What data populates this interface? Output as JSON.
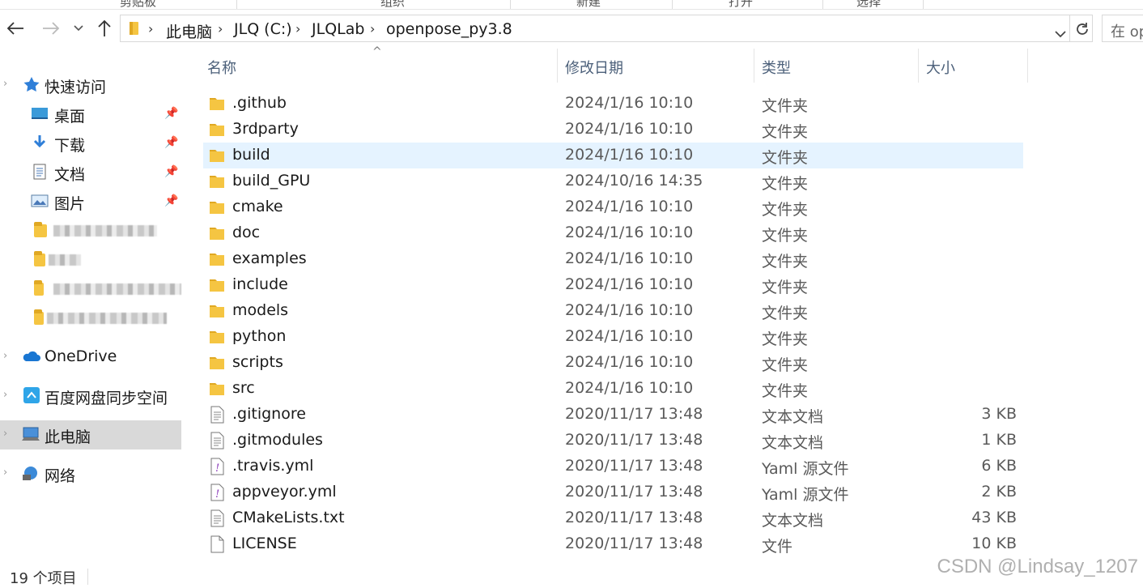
{
  "ribbon": {
    "items": [
      "剪贴板",
      "组织",
      "新建",
      "打开",
      "选择"
    ]
  },
  "nav": {
    "breadcrumbs": [
      "此电脑",
      "JLQ (C:)",
      "JLQLab",
      "openpose_py3.8"
    ],
    "search_placeholder": "在 op"
  },
  "sidebar": {
    "quick_access": "快速访问",
    "pinned": [
      "桌面",
      "下载",
      "文档",
      "图片"
    ],
    "onedrive": "OneDrive",
    "baidu": "百度网盘同步空间",
    "this_pc": "此电脑",
    "network": "网络"
  },
  "columns": {
    "name": "名称",
    "date": "修改日期",
    "type": "类型",
    "size": "大小"
  },
  "files": [
    {
      "name": ".github",
      "date": "2024/1/16 10:10",
      "type": "文件夹",
      "size": "",
      "kind": "folder"
    },
    {
      "name": "3rdparty",
      "date": "2024/1/16 10:10",
      "type": "文件夹",
      "size": "",
      "kind": "folder"
    },
    {
      "name": "build",
      "date": "2024/1/16 10:10",
      "type": "文件夹",
      "size": "",
      "kind": "folder",
      "selected": true
    },
    {
      "name": "build_GPU",
      "date": "2024/10/16 14:35",
      "type": "文件夹",
      "size": "",
      "kind": "folder"
    },
    {
      "name": "cmake",
      "date": "2024/1/16 10:10",
      "type": "文件夹",
      "size": "",
      "kind": "folder"
    },
    {
      "name": "doc",
      "date": "2024/1/16 10:10",
      "type": "文件夹",
      "size": "",
      "kind": "folder"
    },
    {
      "name": "examples",
      "date": "2024/1/16 10:10",
      "type": "文件夹",
      "size": "",
      "kind": "folder"
    },
    {
      "name": "include",
      "date": "2024/1/16 10:10",
      "type": "文件夹",
      "size": "",
      "kind": "folder"
    },
    {
      "name": "models",
      "date": "2024/1/16 10:10",
      "type": "文件夹",
      "size": "",
      "kind": "folder"
    },
    {
      "name": "python",
      "date": "2024/1/16 10:10",
      "type": "文件夹",
      "size": "",
      "kind": "folder"
    },
    {
      "name": "scripts",
      "date": "2024/1/16 10:10",
      "type": "文件夹",
      "size": "",
      "kind": "folder"
    },
    {
      "name": "src",
      "date": "2024/1/16 10:10",
      "type": "文件夹",
      "size": "",
      "kind": "folder"
    },
    {
      "name": ".gitignore",
      "date": "2020/11/17 13:48",
      "type": "文本文档",
      "size": "3 KB",
      "kind": "text"
    },
    {
      "name": ".gitmodules",
      "date": "2020/11/17 13:48",
      "type": "文本文档",
      "size": "1 KB",
      "kind": "text"
    },
    {
      "name": ".travis.yml",
      "date": "2020/11/17 13:48",
      "type": "Yaml 源文件",
      "size": "6 KB",
      "kind": "yaml"
    },
    {
      "name": "appveyor.yml",
      "date": "2020/11/17 13:48",
      "type": "Yaml 源文件",
      "size": "2 KB",
      "kind": "yaml"
    },
    {
      "name": "CMakeLists.txt",
      "date": "2020/11/17 13:48",
      "type": "文本文档",
      "size": "43 KB",
      "kind": "text"
    },
    {
      "name": "LICENSE",
      "date": "2020/11/17 13:48",
      "type": "文件",
      "size": "10 KB",
      "kind": "file"
    }
  ],
  "status": {
    "count": "19 个项目"
  },
  "watermark": "CSDN @Lindsay_1207",
  "colors": {
    "accent": "#0078d4",
    "selected_row": "#e5f3ff",
    "sidebar_selected": "#d9d9d9",
    "folder": "#f5c542"
  }
}
